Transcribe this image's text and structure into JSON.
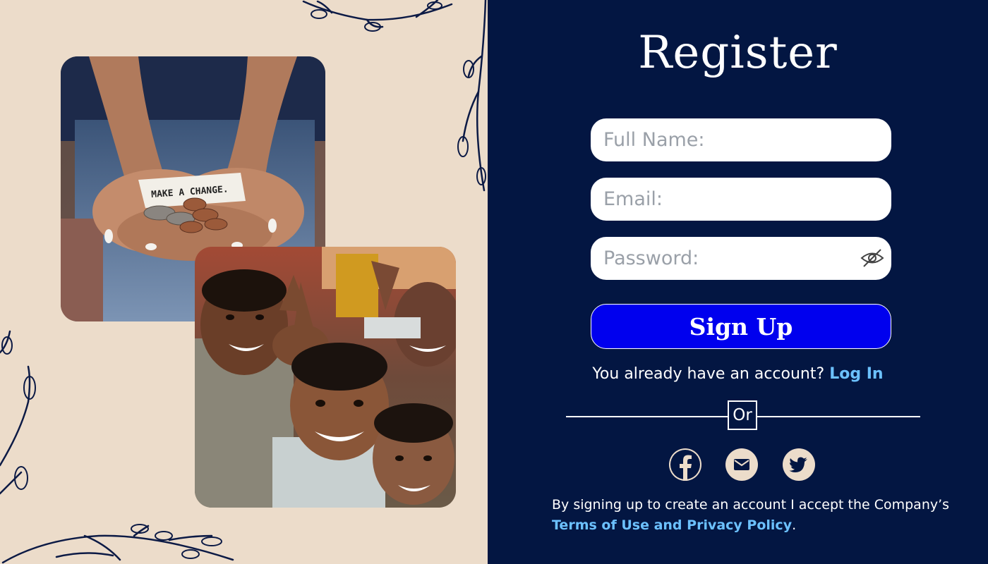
{
  "form": {
    "title": "Register",
    "full_name_placeholder": "Full Name:",
    "email_placeholder": "Email:",
    "password_placeholder": "Password:",
    "signup_label": "Sign Up",
    "account_prompt": "You already have an account?",
    "login_label": "Log In",
    "divider_label": "Or",
    "terms_text": "By signing up to create an account I accept the Company’s",
    "terms_link": "Terms of Use and Privacy Policy",
    "terms_end": "."
  },
  "social": [
    "facebook-icon",
    "mail-icon",
    "twitter-icon"
  ],
  "photos": {
    "hands_note": "MAKE A CHANGE."
  },
  "colors": {
    "left_background": "#ecdcca",
    "right_background": "#031642",
    "primary_button": "#0000ee",
    "link": "#6cc1ff"
  }
}
